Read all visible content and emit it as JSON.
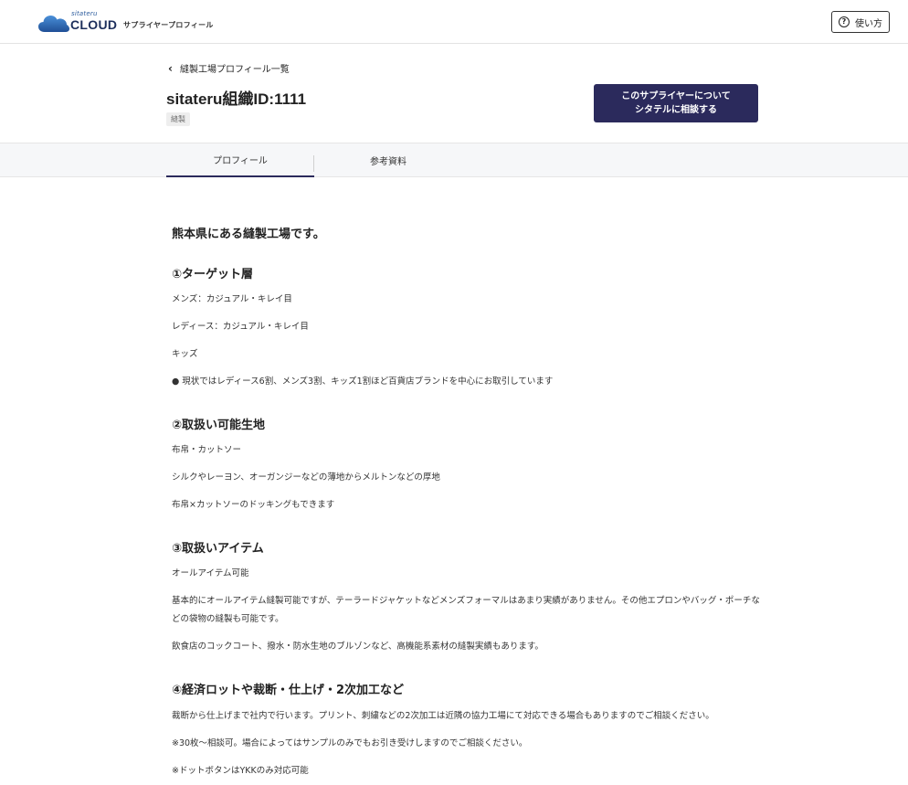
{
  "header": {
    "logo_small": "sitateru",
    "logo_big": "CLOUD",
    "app_name": "サプライヤープロフィール",
    "help_label": "使い方",
    "help_icon": "question-circle-icon"
  },
  "breadcrumb": {
    "back_label": "縫製工場プロフィール一覧",
    "back_icon": "chevron-left-icon"
  },
  "profile": {
    "title": "sitateru組織ID:1111",
    "tag": "縫製",
    "consult_line1": "このサプライヤーについて",
    "consult_line2": "シタテルに相談する"
  },
  "tabs": [
    {
      "label": "プロフィール",
      "active": true
    },
    {
      "label": "参考資料",
      "active": false
    }
  ],
  "content": {
    "lead": "熊本県にある縫製工場です。",
    "sections": [
      {
        "heading": "①ターゲット層",
        "paragraphs": [
          "メンズ：カジュアル・キレイ目",
          "レディース：カジュアル・キレイ目",
          "キッズ",
          "● 現状ではレディース6割、メンズ3割、キッズ1割ほど百貨店ブランドを中心にお取引しています"
        ]
      },
      {
        "heading": "②取扱い可能生地",
        "paragraphs": [
          "布帛・カットソー",
          "シルクやレーヨン、オーガンジーなどの薄地からメルトンなどの厚地",
          "布帛×カットソーのドッキングもできます"
        ]
      },
      {
        "heading": "③取扱いアイテム",
        "paragraphs": [
          "オールアイテム可能",
          "基本的にオールアイテム縫製可能ですが、テーラードジャケットなどメンズフォーマルはあまり実績がありません。その他エプロンやバッグ・ポーチなどの袋物の縫製も可能です。",
          "飲食店のコックコート、撥水・防水生地のブルゾンなど、高機能系素材の縫製実績もあります。"
        ]
      },
      {
        "heading": "④経済ロットや裁断・仕上げ・2次加工など",
        "paragraphs": [
          "裁断から仕上げまで社内で行います。プリント、刺繍などの2次加工は近隣の協力工場にて対応できる場合もありますのでご相談ください。",
          "※30枚～相談可。場合によってはサンプルのみでもお引き受けしますのでご相談ください。",
          "※ドットボタンはYKKのみ対応可能"
        ]
      }
    ]
  },
  "colors": {
    "primary": "#2b2a5c",
    "logo_blue": "#2f5e9e",
    "tab_band": "#f6f7f9"
  }
}
